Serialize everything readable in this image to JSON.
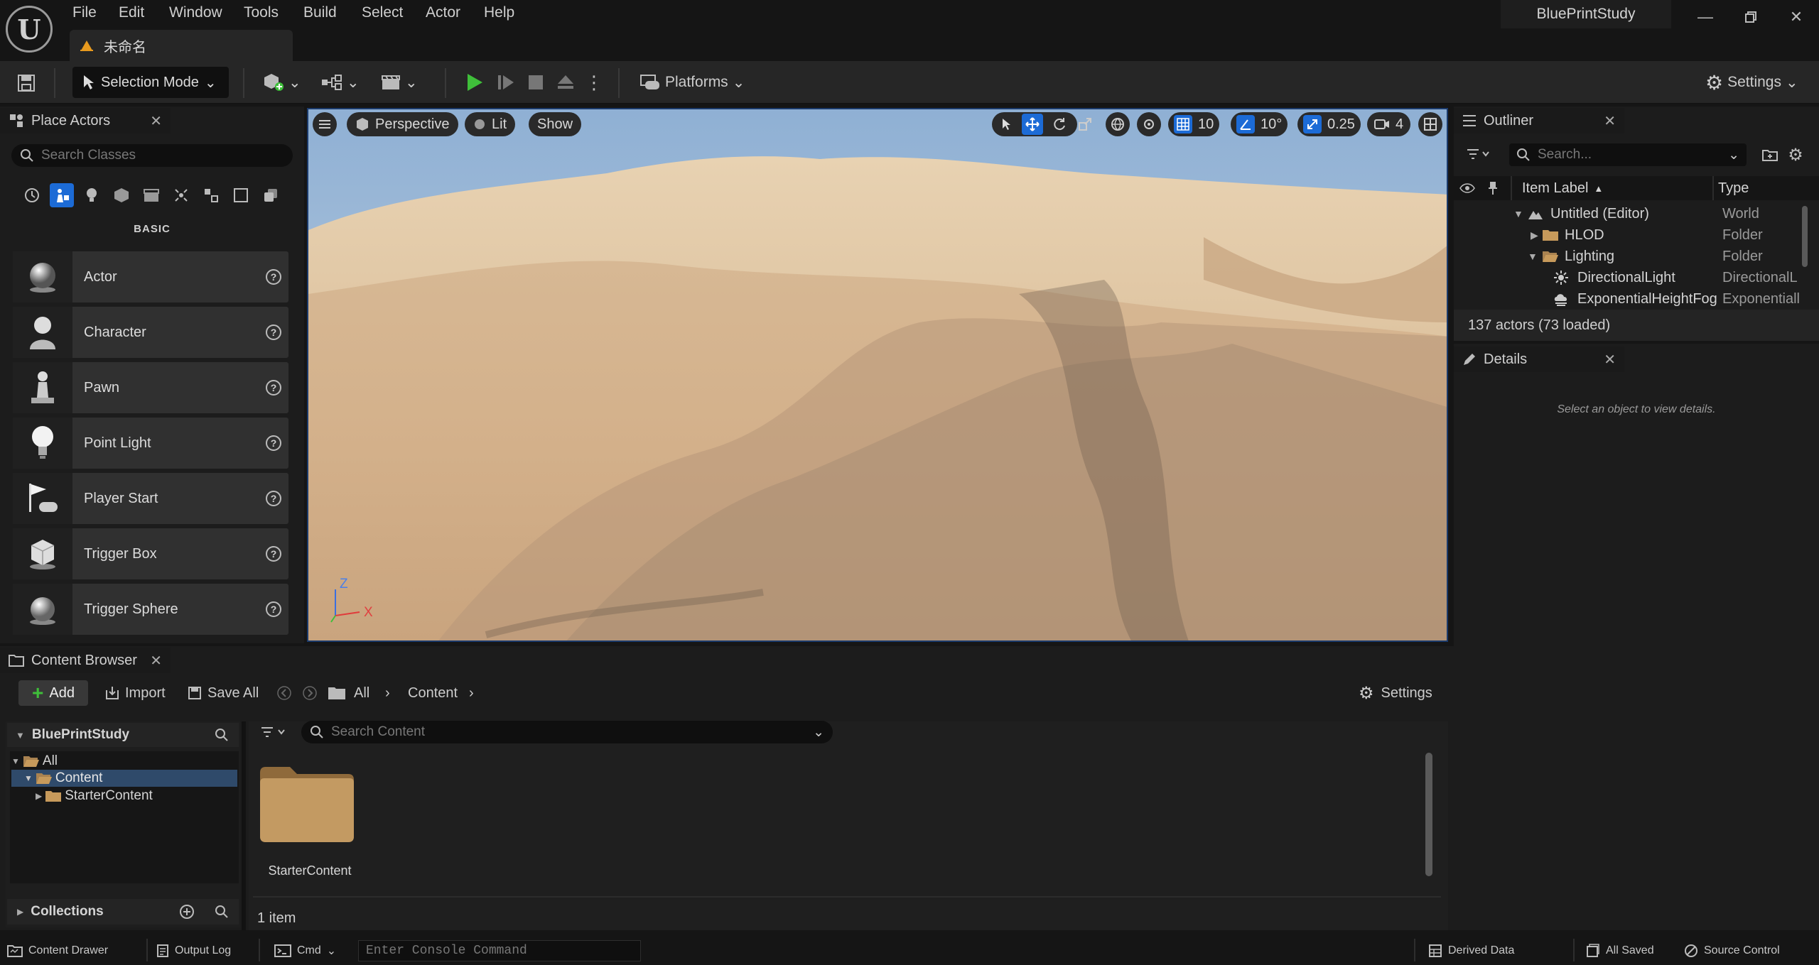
{
  "titlebar": {
    "menu": [
      "File",
      "Edit",
      "Window",
      "Tools",
      "Build",
      "Select",
      "Actor",
      "Help"
    ],
    "doc_tab": "未命名",
    "project": "BluePrintStudy"
  },
  "toolbar": {
    "selection_mode": "Selection Mode",
    "platforms": "Platforms",
    "settings": "Settings"
  },
  "place_actors": {
    "tab": "Place Actors",
    "search_placeholder": "Search Classes",
    "section": "BASIC",
    "items": [
      "Actor",
      "Character",
      "Pawn",
      "Point Light",
      "Player Start",
      "Trigger Box",
      "Trigger Sphere"
    ]
  },
  "viewport": {
    "perspective": "Perspective",
    "lit": "Lit",
    "show": "Show",
    "grid_snap": "10",
    "rot_snap": "10°",
    "scale_snap": "0.25",
    "cam_speed": "4",
    "axis_z": "Z",
    "axis_x": "X"
  },
  "outliner": {
    "tab": "Outliner",
    "search_placeholder": "Search...",
    "col_label": "Item Label",
    "col_type": "Type",
    "rows": [
      {
        "label": "Untitled (Editor)",
        "type": "World"
      },
      {
        "label": "HLOD",
        "type": "Folder"
      },
      {
        "label": "Lighting",
        "type": "Folder"
      },
      {
        "label": "DirectionalLight",
        "type": "DirectionalL"
      },
      {
        "label": "ExponentialHeightFog",
        "type": "Exponentiall"
      }
    ],
    "count": "137 actors (73 loaded)"
  },
  "details": {
    "tab": "Details",
    "empty": "Select an object to view details."
  },
  "content_browser": {
    "tab": "Content Browser",
    "add": "Add",
    "import": "Import",
    "save_all": "Save All",
    "crumb_all": "All",
    "crumb_content": "Content",
    "settings": "Settings",
    "project": "BluePrintStudy",
    "tree": [
      "All",
      "Content",
      "StarterContent"
    ],
    "search_placeholder": "Search Content",
    "folder_name": "StarterContent",
    "item_count": "1 item",
    "collections": "Collections"
  },
  "statusbar": {
    "content_drawer": "Content Drawer",
    "output_log": "Output Log",
    "cmd": "Cmd",
    "console_placeholder": "Enter Console Command",
    "derived_data": "Derived Data",
    "all_saved": "All Saved",
    "source_control": "Source Control"
  },
  "colors": {
    "accent_blue": "#1c6bd6",
    "play_green": "#3fbf3a",
    "folder": "#c79a5b"
  }
}
